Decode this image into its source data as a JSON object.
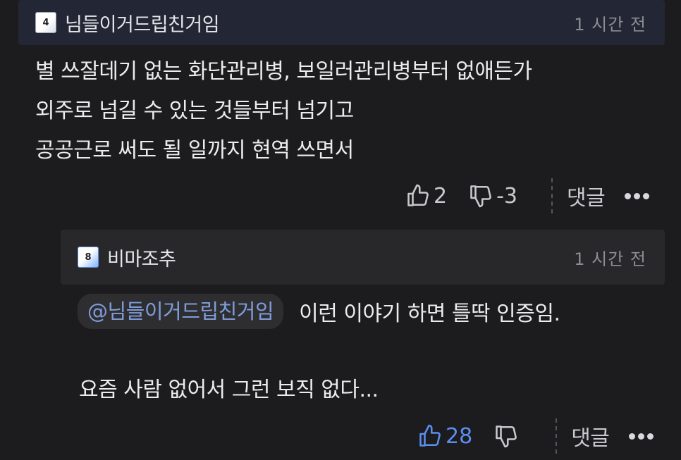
{
  "comment": {
    "badge_level": "4",
    "username": "님들이거드립친거임",
    "timestamp": "1 시간 전",
    "body_lines": [
      "별 쓰잘데기 없는 화단관리병, 보일러관리병부터 없애든가",
      "외주로 넘길 수 있는 것들부터 넘기고",
      "공공근로 써도 될 일까지 현역 쓰면서"
    ],
    "likes": "2",
    "dislikes": "-3",
    "reply_label": "댓글"
  },
  "reply": {
    "badge_level": "8",
    "username": "비마조추",
    "timestamp": "1 시간 전",
    "mention": "@님들이거드립친거임",
    "line1": "이런 이야기 하면 틀딱 인증임.",
    "line2": "요즘 사람 없어서 그런 보직 없다...",
    "likes": "28",
    "reply_label": "댓글"
  },
  "colors": {
    "background": "#1c1c1e",
    "main_header": "#232634",
    "reply_header": "#28282b",
    "mention_text": "#7f9cd9",
    "liked_accent": "#5b8ef0"
  },
  "icons": [
    "thumbs-up-icon",
    "thumbs-down-icon",
    "more-dots-icon",
    "level-badge-icon"
  ]
}
